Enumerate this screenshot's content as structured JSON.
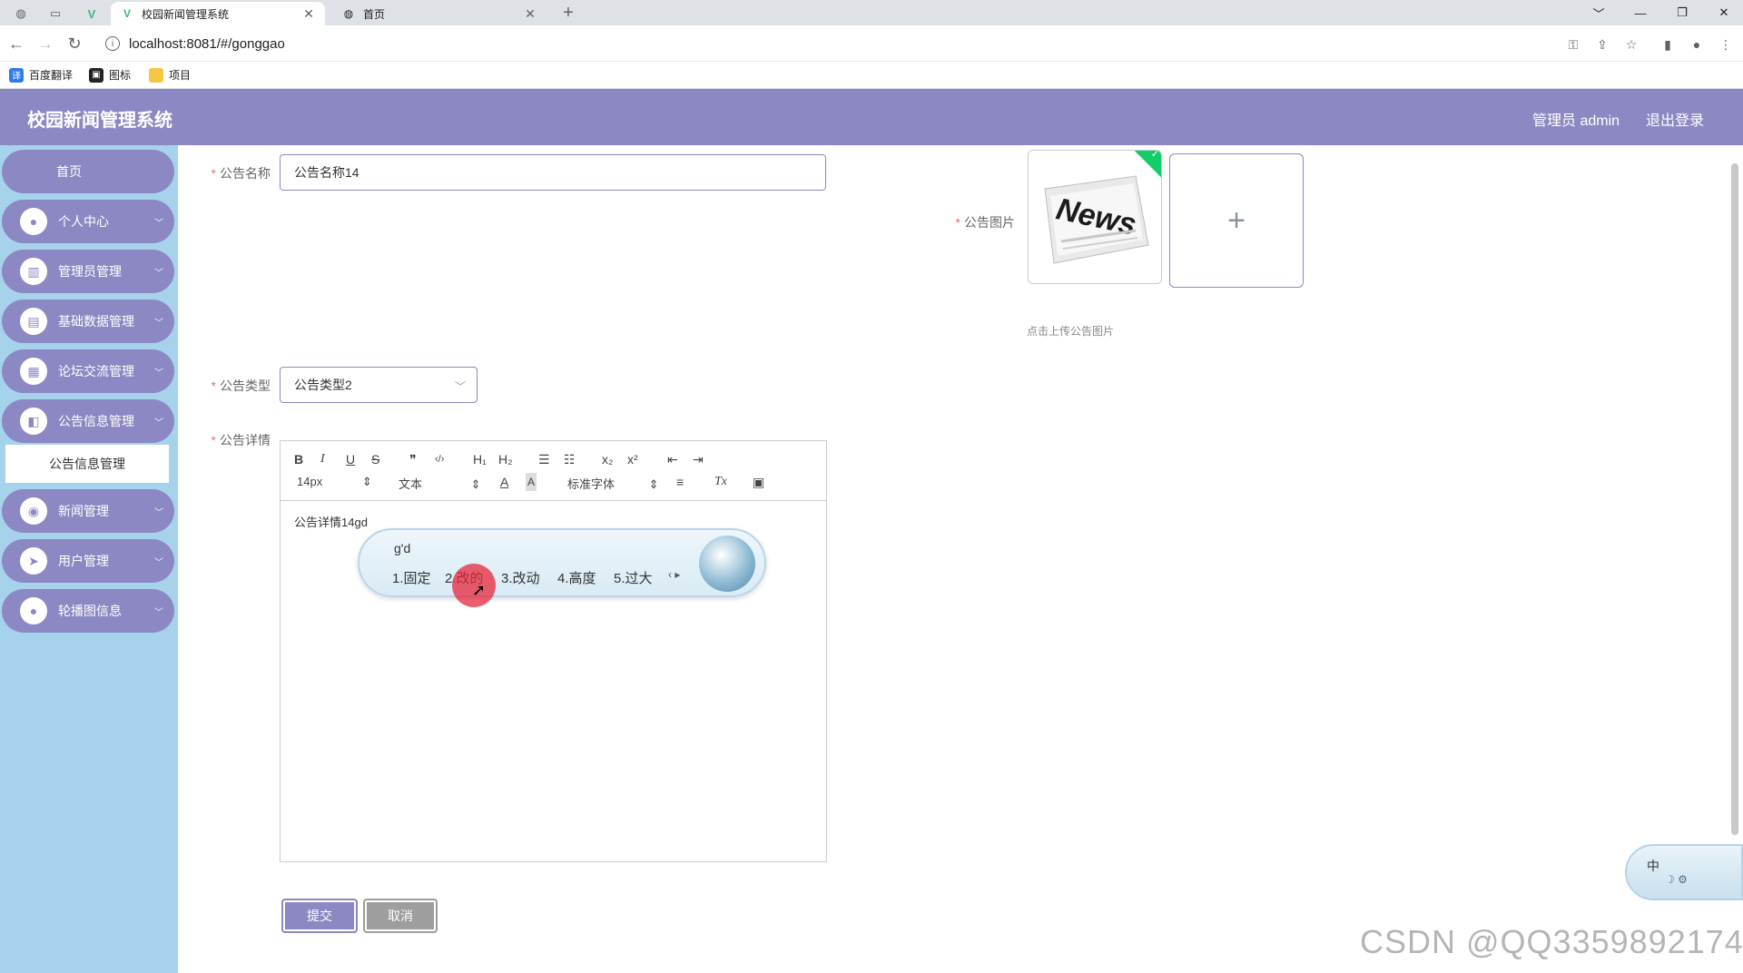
{
  "browser": {
    "tabs": [
      {
        "title": "校园新闻管理系统",
        "active": true
      },
      {
        "title": "首页",
        "active": false
      }
    ],
    "new_tab": "+",
    "url": "localhost:8081/#/gonggao",
    "bookmarks": [
      "百度翻译",
      "图标",
      "项目"
    ],
    "window_controls": [
      "﹀",
      "—",
      "❐",
      "✕"
    ]
  },
  "header": {
    "title": "校园新闻管理系统",
    "user": "管理员 admin",
    "logout": "退出登录",
    "color": "#8c88c3"
  },
  "sidebar": {
    "background": "#a6d2ec",
    "home": "首页",
    "items": [
      {
        "label": "个人中心",
        "icon": "user-icon"
      },
      {
        "label": "管理员管理",
        "icon": "grid-icon"
      },
      {
        "label": "基础数据管理",
        "icon": "clipboard-icon"
      },
      {
        "label": "论坛交流管理",
        "icon": "apps-icon"
      },
      {
        "label": "公告信息管理",
        "icon": "ticket-icon"
      },
      {
        "label": "新闻管理",
        "icon": "pin-icon"
      },
      {
        "label": "用户管理",
        "icon": "send-icon"
      },
      {
        "label": "轮播图信息",
        "icon": "user-icon"
      }
    ],
    "active_sub": "公告信息管理"
  },
  "form": {
    "name_label": "公告名称",
    "name_value": "公告名称14",
    "image_label": "公告图片",
    "image_alt": "News",
    "image_tip": "点击上传公告图片",
    "type_label": "公告类型",
    "type_value": "公告类型2",
    "detail_label": "公告详情",
    "detail_value": "公告详情14gd",
    "submit": "提交",
    "cancel": "取消"
  },
  "editor": {
    "toolbar": [
      "B",
      "I",
      "U",
      "S",
      "❞",
      "‹/›",
      "H₁",
      "H₂",
      "☰",
      "☷",
      "x₂",
      "x²",
      "⇤",
      "⇥"
    ],
    "font_size": "14px",
    "format": "文本",
    "font_family": "标准字体"
  },
  "ime": {
    "input": "g'd",
    "candidates": [
      "1.固定",
      "2.改的",
      "3.改动",
      "4.高度",
      "5.过大"
    ],
    "mode": "中"
  },
  "watermark": "CSDN @QQ3359892174"
}
